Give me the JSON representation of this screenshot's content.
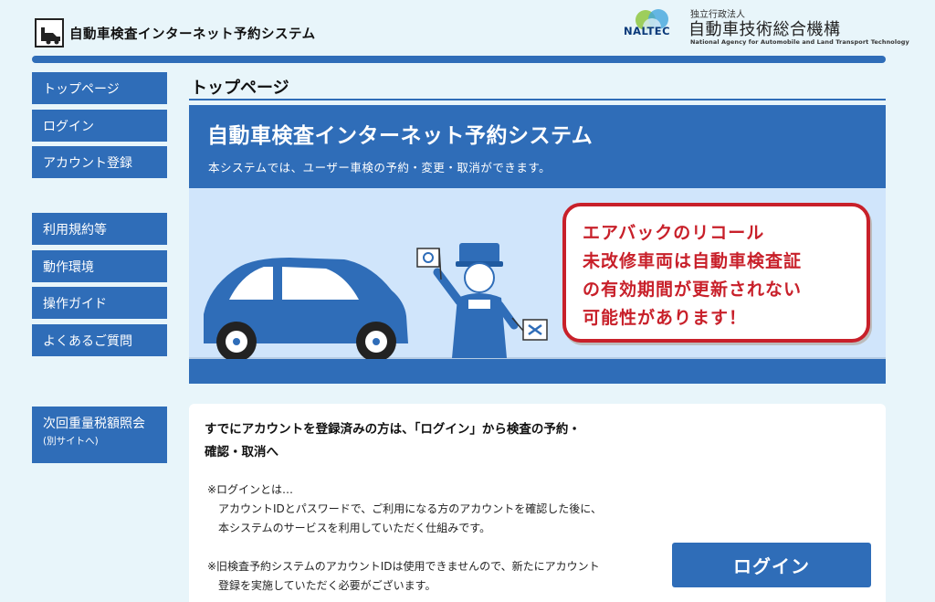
{
  "header": {
    "site_title": "自動車検査インターネット予約システム",
    "org_logo_text": "NALTEC",
    "org_small": "独立行政法人",
    "org_name": "自動車技術総合機構",
    "org_english": "National Agency for Automobile and Land Transport Technology"
  },
  "sidebar": {
    "items": [
      {
        "label": "トップページ"
      },
      {
        "label": "ログイン"
      },
      {
        "label": "アカウント登録"
      },
      {
        "label": "利用規約等"
      },
      {
        "label": "動作環境"
      },
      {
        "label": "操作ガイド"
      },
      {
        "label": "よくあるご質問"
      },
      {
        "label": "次回重量税額照会",
        "sub": "(別サイトへ)"
      }
    ]
  },
  "page": {
    "heading": "トップページ"
  },
  "banner": {
    "title": "自動車検査インターネット予約システム",
    "subtitle": "本システムでは、ユーザー車検の予約・変更・取消ができます。",
    "notice_lines": [
      "エアバックのリコール",
      "未改修車両は自動車検査証",
      "の有効期間が更新されない",
      "可能性があります！"
    ]
  },
  "info": {
    "lead_line1": "すでにアカウントを登録済みの方は、「ログイン」から検査の予約・",
    "lead_line2": "確認・取消へ",
    "note1_title": "※ログインとは…",
    "note1_line1": "アカウントIDとパスワードで、ご利用になる方のアカウントを確認した後に、",
    "note1_line2": "本システムのサービスを利用していただく仕組みです。",
    "note2_line1": "※旧検査予約システムのアカウントIDは使用できませんので、新たにアカウント",
    "note2_line2": "登録を実施していただく必要がございます。",
    "login_button": "ログイン"
  },
  "colors": {
    "brand_blue": "#2f6db8",
    "page_bg": "#e8f5fa",
    "notice_red": "#c8202a"
  }
}
